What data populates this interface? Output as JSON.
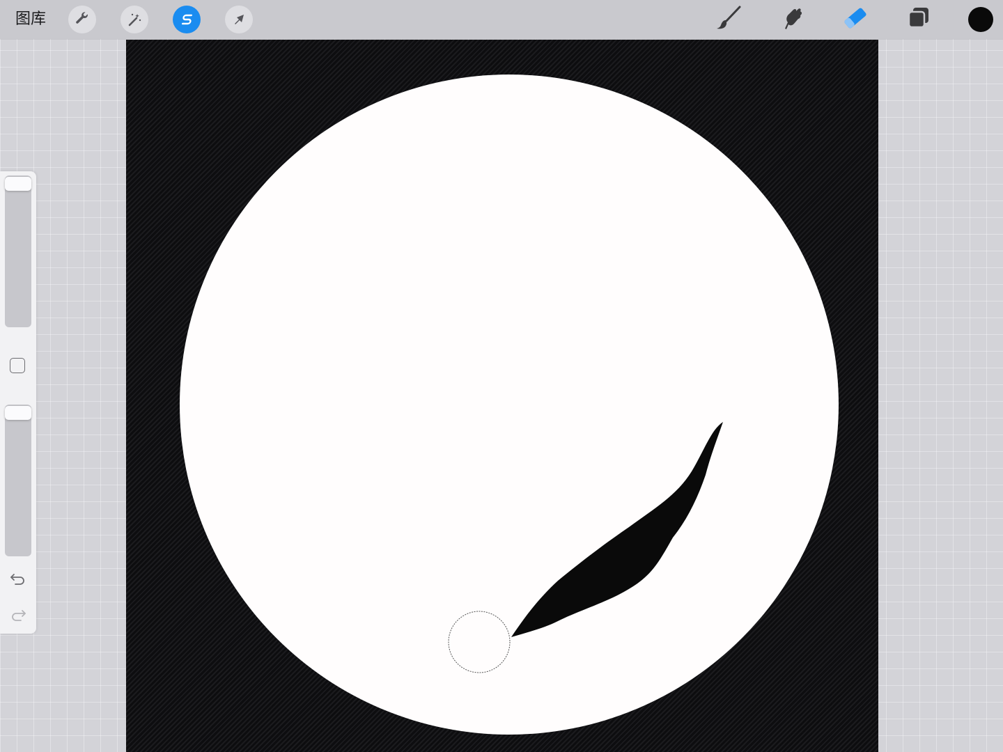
{
  "app": {
    "gallery_label": "图库"
  },
  "toolbar": {
    "left_tools": [
      {
        "name": "actions-button",
        "icon": "wrench-icon",
        "active": false
      },
      {
        "name": "adjustments-button",
        "icon": "magic-wand-icon",
        "active": false
      },
      {
        "name": "selection-button",
        "icon": "selection-s-icon",
        "active": true
      },
      {
        "name": "transform-button",
        "icon": "arrow-cursor-icon",
        "active": false
      }
    ],
    "right_tools": [
      {
        "name": "brush-button",
        "icon": "brush-icon",
        "active": false
      },
      {
        "name": "smudge-button",
        "icon": "smudge-hand-icon",
        "active": false
      },
      {
        "name": "eraser-button",
        "icon": "eraser-icon",
        "active": true
      },
      {
        "name": "layers-button",
        "icon": "layers-icon",
        "active": false
      }
    ],
    "current_color": "#0a0a0a",
    "accent_color": "#1a8cf0"
  },
  "sidebar": {
    "brush_size_level": 1.0,
    "opacity_level": 1.0,
    "icons": [
      "modify-square-icon",
      "undo-icon",
      "redo-icon"
    ]
  },
  "canvas": {
    "background_color": "#111113",
    "disc_color": "#fffdfd",
    "stroke_color": "#0a0a0a"
  }
}
